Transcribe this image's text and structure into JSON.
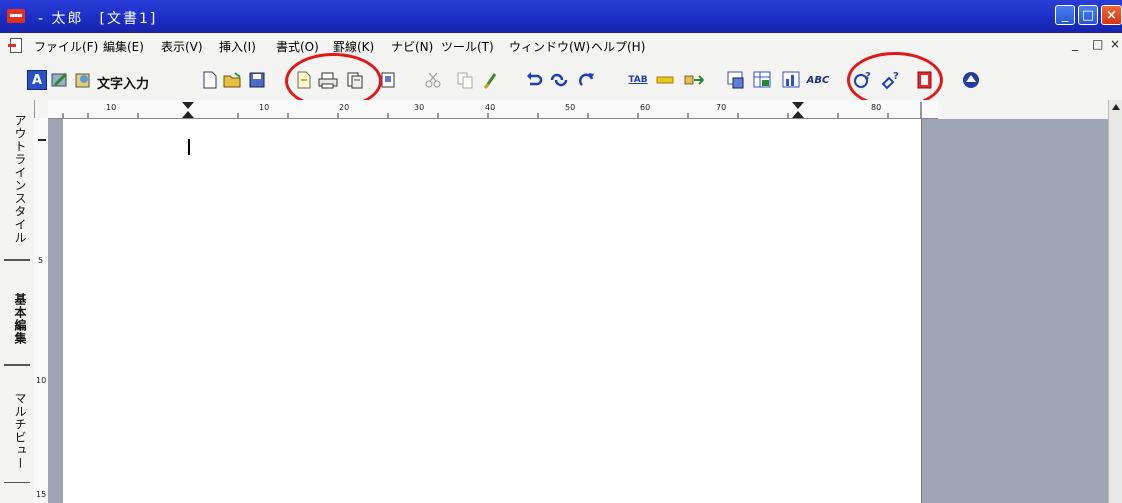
{
  "window": {
    "title": "- 太郎　[文書1]",
    "controls": {
      "minimize": "_",
      "restore": "□",
      "close": "×"
    }
  },
  "menubar": {
    "items": [
      "ファイル(F)",
      "編集(E)",
      "表示(V)",
      "挿入(I)",
      "書式(O)",
      "罫線(K)",
      "ナビ(N)",
      "ツール(T)",
      "ウィンドウ(W)",
      "ヘルプ(H)"
    ],
    "mdi_controls": {
      "minimize": "_",
      "restore": "□",
      "close": "×"
    }
  },
  "toolbar": {
    "text_input_label": "文字入力",
    "tab_label": "TAB",
    "abc_label": "ABC"
  },
  "sidebar": {
    "tabs": [
      "アウトラインスタイル",
      "基本編集",
      "マルチビュー"
    ]
  },
  "rulers": {
    "horizontal_ticks": [
      "10",
      "10",
      "20",
      "30",
      "40",
      "50",
      "60",
      "70",
      "80"
    ],
    "vertical_ticks": [
      "5",
      "10",
      "15"
    ]
  },
  "colors": {
    "titlebar": "#1a2cc4",
    "highlight_circle": "#e01818",
    "page": "#ffffff",
    "workspace": "#9ca6b4"
  }
}
